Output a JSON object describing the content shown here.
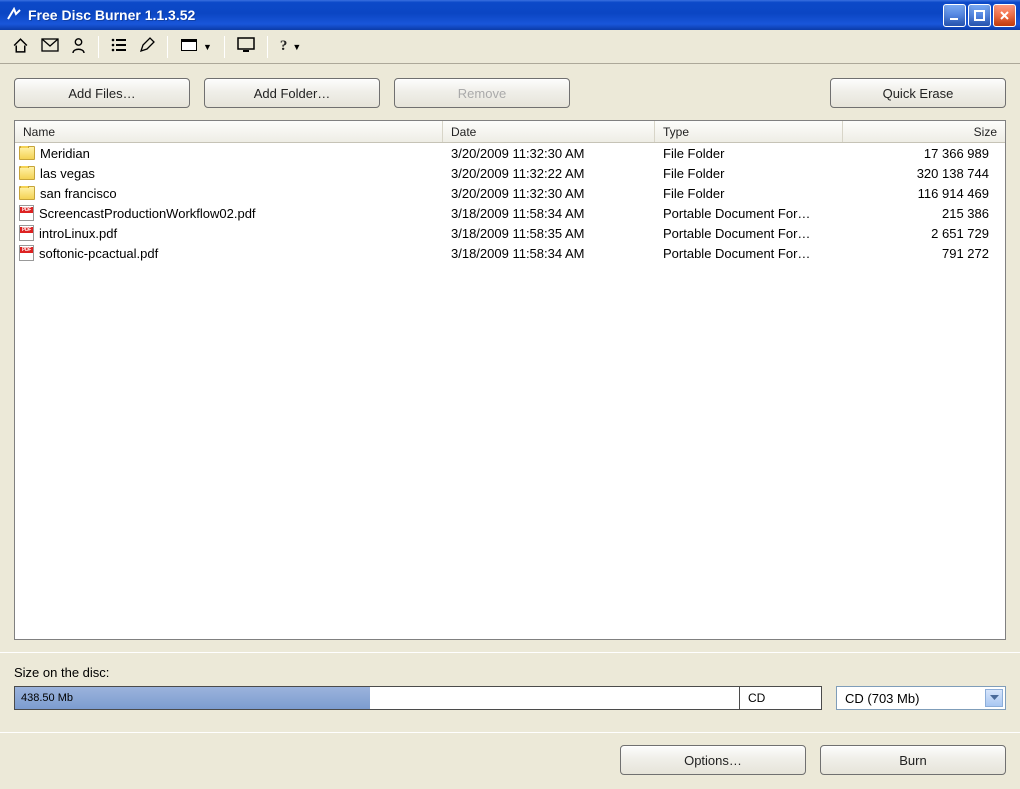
{
  "window": {
    "title": "Free Disc Burner 1.1.3.52"
  },
  "toolbar": {
    "home": "home",
    "mail": "mail",
    "user": "user",
    "list": "list",
    "edit": "edit",
    "panel": "panel",
    "monitor": "monitor",
    "help": "?"
  },
  "buttons": {
    "add_files": "Add Files…",
    "add_folder": "Add Folder…",
    "remove": "Remove",
    "quick_erase": "Quick Erase",
    "options": "Options…",
    "burn": "Burn"
  },
  "columns": {
    "name": "Name",
    "date": "Date",
    "type": "Type",
    "size": "Size"
  },
  "files": [
    {
      "icon": "folder",
      "name": "Meridian",
      "date": "3/20/2009 11:32:30 AM",
      "type": "File Folder",
      "size": "17 366 989"
    },
    {
      "icon": "folder",
      "name": "las vegas",
      "date": "3/20/2009 11:32:22 AM",
      "type": "File Folder",
      "size": "320 138 744"
    },
    {
      "icon": "folder",
      "name": "san francisco",
      "date": "3/20/2009 11:32:30 AM",
      "type": "File Folder",
      "size": "116 914 469"
    },
    {
      "icon": "pdf",
      "name": "ScreencastProductionWorkflow02.pdf",
      "date": "3/18/2009 11:58:34 AM",
      "type": "Portable Document For…",
      "size": "215 386"
    },
    {
      "icon": "pdf",
      "name": "introLinux.pdf",
      "date": "3/18/2009 11:58:35 AM",
      "type": "Portable Document For…",
      "size": "2 651 729"
    },
    {
      "icon": "pdf",
      "name": "softonic-pcactual.pdf",
      "date": "3/18/2009 11:58:34 AM",
      "type": "Portable Document For…",
      "size": "791 272"
    }
  ],
  "disc": {
    "label": "Size on the disc:",
    "used_label": "438.50 Mb",
    "fill_percent": 44,
    "marker": "CD",
    "selected": "CD (703 Mb)"
  }
}
